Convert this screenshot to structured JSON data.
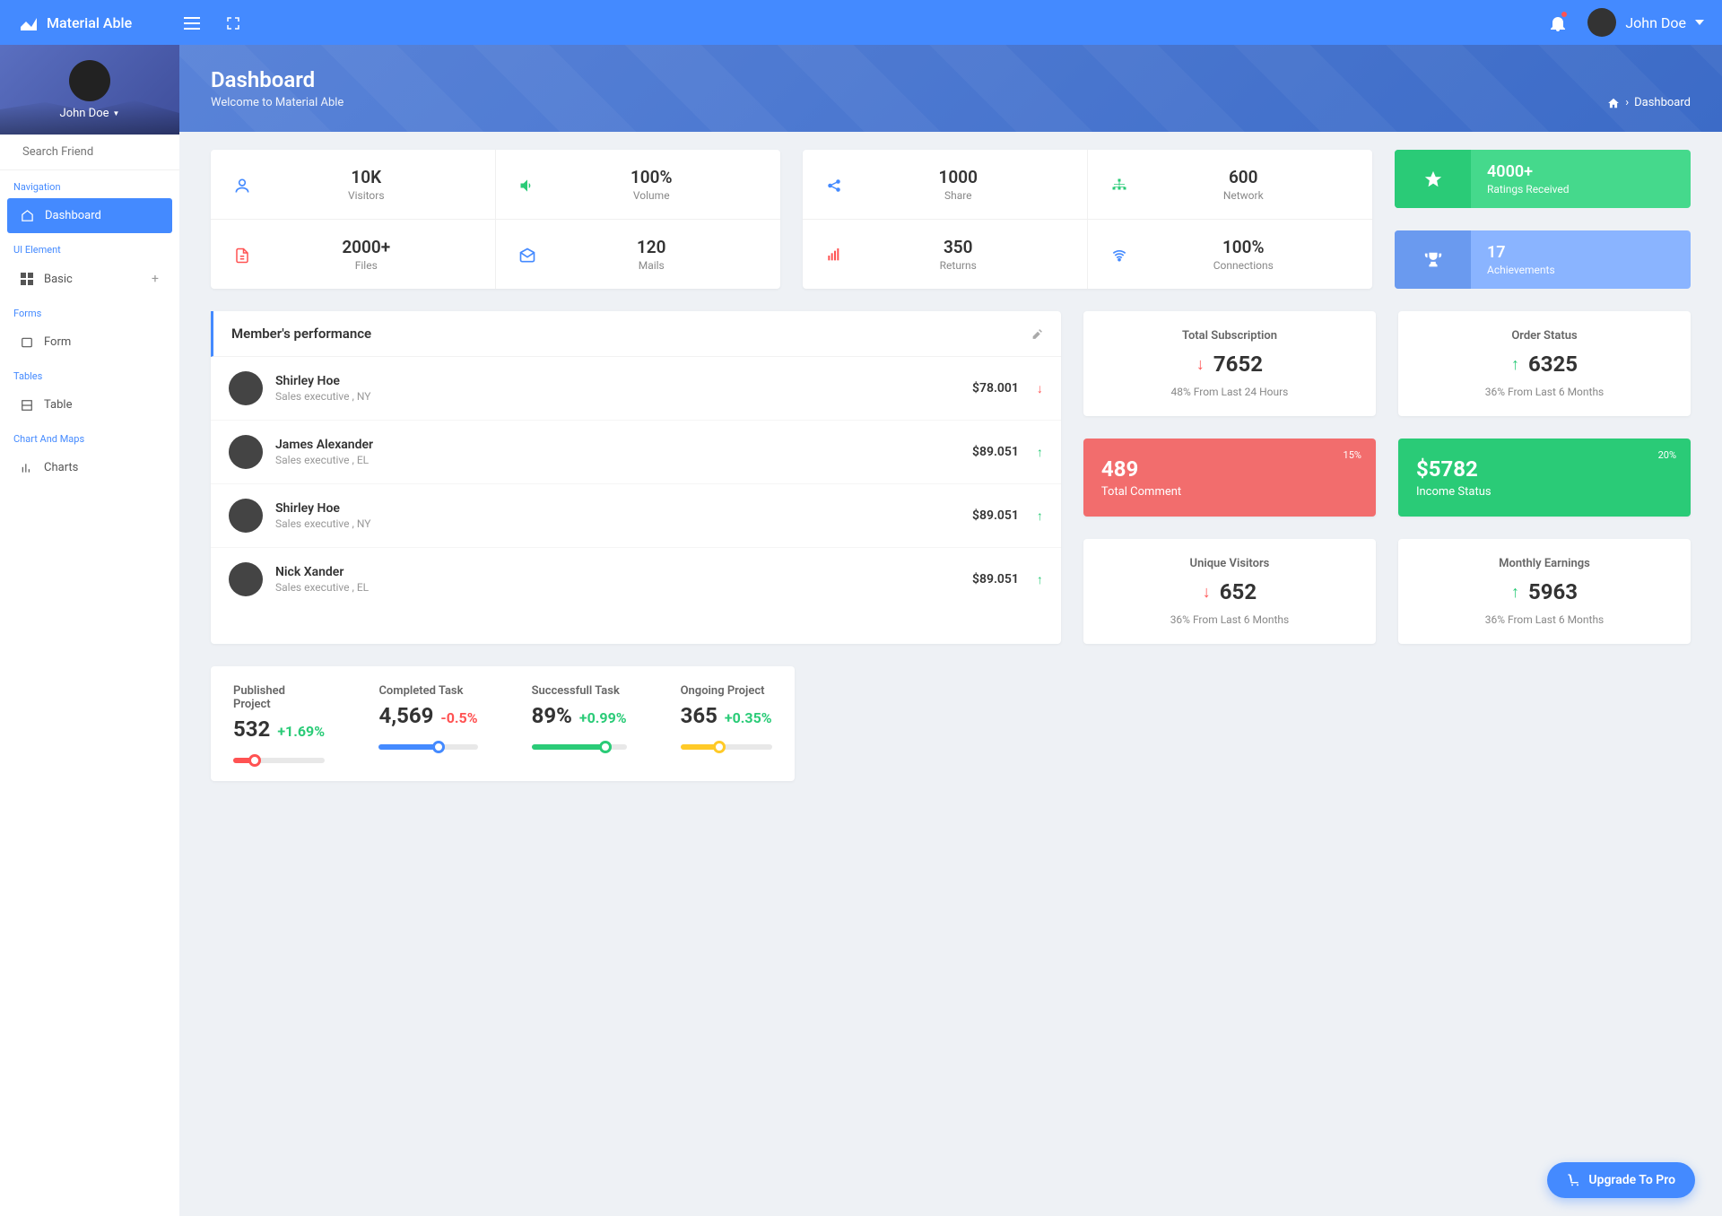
{
  "brand": "Material Able",
  "user": {
    "name": "John Doe"
  },
  "sidebar": {
    "user_name": "John Doe",
    "search_placeholder": "Search Friend",
    "sections": {
      "nav": "Navigation",
      "ui": "UI Element",
      "forms": "Forms",
      "tables": "Tables",
      "charts": "Chart And Maps"
    },
    "items": {
      "dashboard": "Dashboard",
      "basic": "Basic",
      "form": "Form",
      "table": "Table",
      "charts": "Charts"
    }
  },
  "page": {
    "title": "Dashboard",
    "subtitle": "Welcome to Material Able",
    "crumb": "Dashboard"
  },
  "stats1": [
    {
      "value": "10K",
      "label": "Visitors",
      "color": "#448aff"
    },
    {
      "value": "100%",
      "label": "Volume",
      "color": "#2acb77"
    },
    {
      "value": "2000+",
      "label": "Files",
      "color": "#ff5252"
    },
    {
      "value": "120",
      "label": "Mails",
      "color": "#448aff"
    }
  ],
  "stats2": [
    {
      "value": "1000",
      "label": "Share",
      "color": "#448aff"
    },
    {
      "value": "600",
      "label": "Network",
      "color": "#2acb77"
    },
    {
      "value": "350",
      "label": "Returns",
      "color": "#ff5252"
    },
    {
      "value": "100%",
      "label": "Connections",
      "color": "#448aff"
    }
  ],
  "tiles": [
    {
      "value": "4000+",
      "label": "Ratings Received"
    },
    {
      "value": "17",
      "label": "Achievements"
    }
  ],
  "performance": {
    "title": "Member's performance",
    "rows": [
      {
        "name": "Shirley Hoe",
        "role": "Sales executive , NY",
        "amount": "$78.001",
        "dir": "down"
      },
      {
        "name": "James Alexander",
        "role": "Sales executive , EL",
        "amount": "$89.051",
        "dir": "up"
      },
      {
        "name": "Shirley Hoe",
        "role": "Sales executive , NY",
        "amount": "$89.051",
        "dir": "up"
      },
      {
        "name": "Nick Xander",
        "role": "Sales executive , EL",
        "amount": "$89.051",
        "dir": "up"
      }
    ]
  },
  "kpis_a": [
    {
      "title": "Total Subscription",
      "value": "7652",
      "dir": "down",
      "note": "48% From Last 24 Hours"
    },
    {
      "title": "Order Status",
      "value": "6325",
      "dir": "up",
      "note": "36% From Last 6 Months"
    }
  ],
  "kpis_fill": [
    {
      "value": "489",
      "label": "Total Comment",
      "pct": "15%"
    },
    {
      "value": "$5782",
      "label": "Income Status",
      "pct": "20%"
    }
  ],
  "kpis_b": [
    {
      "title": "Unique Visitors",
      "value": "652",
      "dir": "down",
      "note": "36% From Last 6 Months"
    },
    {
      "title": "Monthly Earnings",
      "value": "5963",
      "dir": "up",
      "note": "36% From Last 6 Months"
    }
  ],
  "projects": [
    {
      "title": "Published Project",
      "value": "532",
      "change": "+1.69%",
      "dir": "up",
      "color": "#ff5252",
      "pct": 23
    },
    {
      "title": "Completed Task",
      "value": "4,569",
      "change": "-0.5%",
      "dir": "down",
      "color": "#448aff",
      "pct": 60
    },
    {
      "title": "Successfull Task",
      "value": "89%",
      "change": "+0.99%",
      "dir": "up",
      "color": "#2acb77",
      "pct": 78
    },
    {
      "title": "Ongoing Project",
      "value": "365",
      "change": "+0.35%",
      "dir": "up",
      "color": "#ffca28",
      "pct": 42
    }
  ],
  "upgrade": "Upgrade To Pro"
}
